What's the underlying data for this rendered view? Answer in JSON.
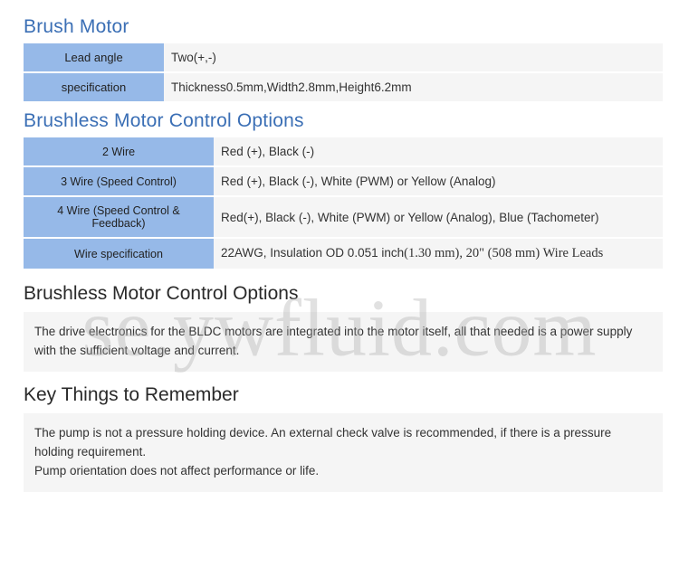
{
  "brush_motor": {
    "title": "Brush Motor",
    "rows": [
      {
        "label": "Lead angle",
        "value": "Two(+,-)"
      },
      {
        "label": "specification",
        "value": "Thickness0.5mm,Width2.8mm,Height6.2mm"
      }
    ]
  },
  "brushless_options": {
    "title": "Brushless Motor Control Options",
    "rows": [
      {
        "label": "2 Wire",
        "value": "Red (+), Black (-)"
      },
      {
        "label": "3 Wire (Speed Control)",
        "value": "Red (+), Black (-), White (PWM) or Yellow (Analog)"
      },
      {
        "label": "4 Wire (Speed Control & Feedback)",
        "value": "Red(+), Black (-), White (PWM) or Yellow (Analog), Blue (Tachometer)"
      },
      {
        "label": "Wire specification",
        "value_prefix": "22AWG, Insulation OD 0.051 inch",
        "value_suffix": "(1.30 mm), 20\" (508 mm) Wire Leads"
      }
    ]
  },
  "brushless_desc": {
    "title": "Brushless Motor Control Options",
    "text": "The drive electronics for the BLDC motors are integrated into the motor itself, all that needed is a power supply with the sufficient voltage and current."
  },
  "key_things": {
    "title": "Key Things to Remember",
    "line1": "The pump is not a pressure holding device. An external check valve is recommended, if there is a pressure holding requirement.",
    "line2": "Pump orientation does not affect performance or life."
  },
  "watermark": "se.ywfluid.com"
}
